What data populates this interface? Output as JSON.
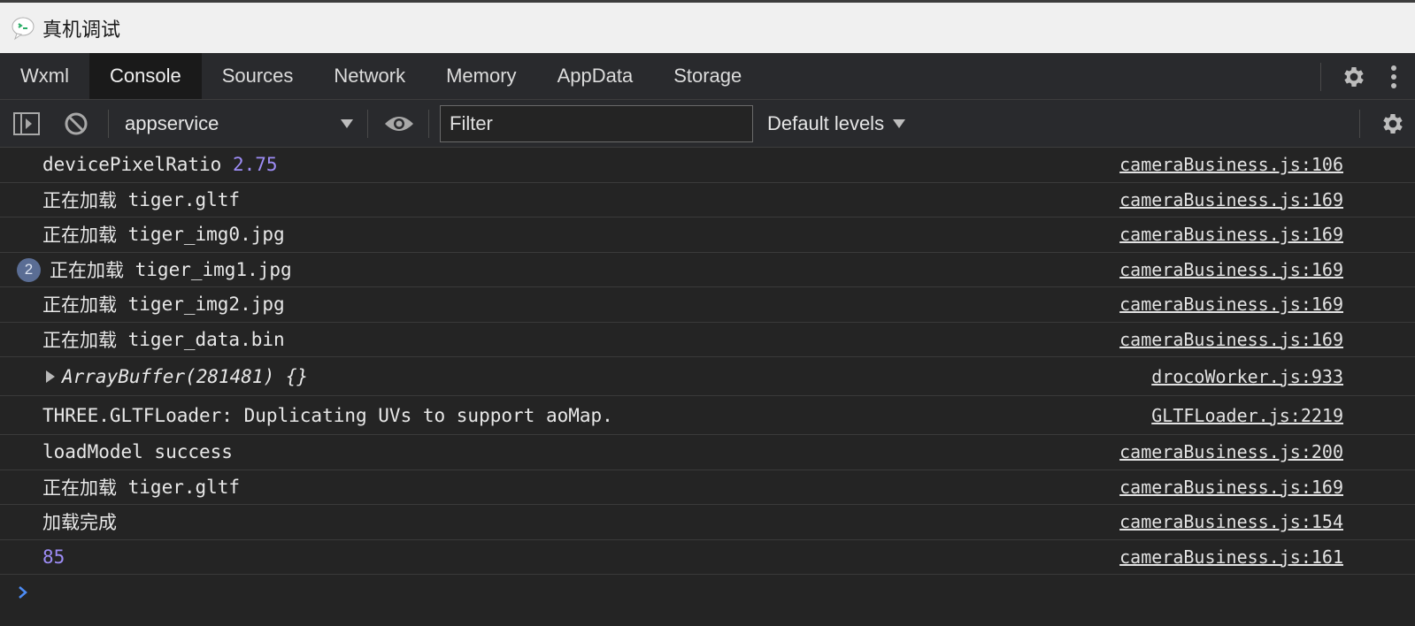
{
  "window": {
    "title": "真机调试"
  },
  "tabs": [
    {
      "label": "Wxml",
      "active": false
    },
    {
      "label": "Console",
      "active": true
    },
    {
      "label": "Sources",
      "active": false
    },
    {
      "label": "Network",
      "active": false
    },
    {
      "label": "Memory",
      "active": false
    },
    {
      "label": "AppData",
      "active": false
    },
    {
      "label": "Storage",
      "active": false
    }
  ],
  "toolbar": {
    "context": "appservice",
    "filter_placeholder": "Filter",
    "levels": "Default levels"
  },
  "messages": [
    {
      "prefix": "devicePixelRatio ",
      "value": "2.75",
      "source": "cameraBusiness.js:106"
    },
    {
      "cjk": "正在加载",
      "text": " tiger.gltf",
      "source": "cameraBusiness.js:169"
    },
    {
      "cjk": "正在加载",
      "text": " tiger_img0.jpg",
      "source": "cameraBusiness.js:169"
    },
    {
      "badge": "2",
      "cjk": "正在加载",
      "text": " tiger_img1.jpg",
      "source": "cameraBusiness.js:169"
    },
    {
      "cjk": "正在加载",
      "text": " tiger_img2.jpg",
      "source": "cameraBusiness.js:169"
    },
    {
      "cjk": "正在加载",
      "text": " tiger_data.bin",
      "source": "cameraBusiness.js:169"
    },
    {
      "object": "ArrayBuffer(281481) {}",
      "source": "drocoWorker.js:933"
    },
    {
      "text": "THREE.GLTFLoader: Duplicating UVs to support aoMap.",
      "source": "GLTFLoader.js:2219"
    },
    {
      "text": "loadModel success",
      "source": "cameraBusiness.js:200"
    },
    {
      "cjk": "正在加载",
      "text": " tiger.gltf",
      "source": "cameraBusiness.js:169"
    },
    {
      "cjk": "加载完成",
      "source": "cameraBusiness.js:154"
    },
    {
      "value": "85",
      "source": "cameraBusiness.js:161"
    }
  ],
  "colors": {
    "accent_number": "#9d8cf5",
    "prompt": "#4d8cf5",
    "background": "#242424"
  }
}
